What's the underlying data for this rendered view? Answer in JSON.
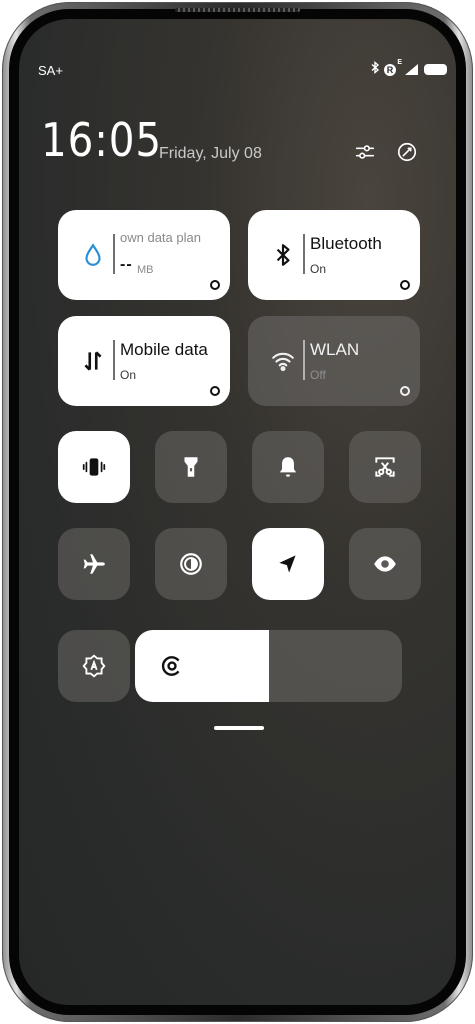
{
  "status_bar": {
    "carrier": "SA+",
    "icons": [
      "bluetooth-icon",
      "roaming-icon",
      "signal-icon",
      "battery-icon"
    ],
    "roaming_letter": "R",
    "roaming_sup": "E"
  },
  "header": {
    "time": "16:05",
    "date": "Friday, July 08",
    "buttons": [
      "settings-sliders-icon",
      "edit-icon"
    ]
  },
  "tiles": {
    "data_plan": {
      "title": "own data plan",
      "value": "--",
      "unit": "MB",
      "state": "on"
    },
    "bluetooth": {
      "title": "Bluetooth",
      "status": "On",
      "state": "on"
    },
    "mobile_data": {
      "title": "Mobile data",
      "status": "On",
      "state": "on"
    },
    "wlan": {
      "title": "WLAN",
      "status": "Off",
      "state": "off"
    }
  },
  "toggles": [
    {
      "name": "vibrate",
      "icon": "vibrate-icon",
      "state": "on"
    },
    {
      "name": "flashlight",
      "icon": "flashlight-icon",
      "state": "off"
    },
    {
      "name": "ringer",
      "icon": "bell-icon",
      "state": "off"
    },
    {
      "name": "screenshot",
      "icon": "scissors-icon",
      "state": "off"
    },
    {
      "name": "airplane",
      "icon": "airplane-icon",
      "state": "off"
    },
    {
      "name": "dark-mode",
      "icon": "contrast-icon",
      "state": "off"
    },
    {
      "name": "location",
      "icon": "location-arrow-icon",
      "state": "on"
    },
    {
      "name": "reading-mode",
      "icon": "eye-icon",
      "state": "off"
    },
    {
      "name": "auto-brightness",
      "icon": "auto-brightness-icon",
      "state": "off"
    }
  ],
  "brightness": {
    "level": 0.5,
    "icon": "brightness-icon"
  },
  "colors": {
    "tile_on": "#ffffff",
    "tile_off": "#6a6865",
    "background": "#2e2f2d",
    "text_light": "#ffffff"
  }
}
